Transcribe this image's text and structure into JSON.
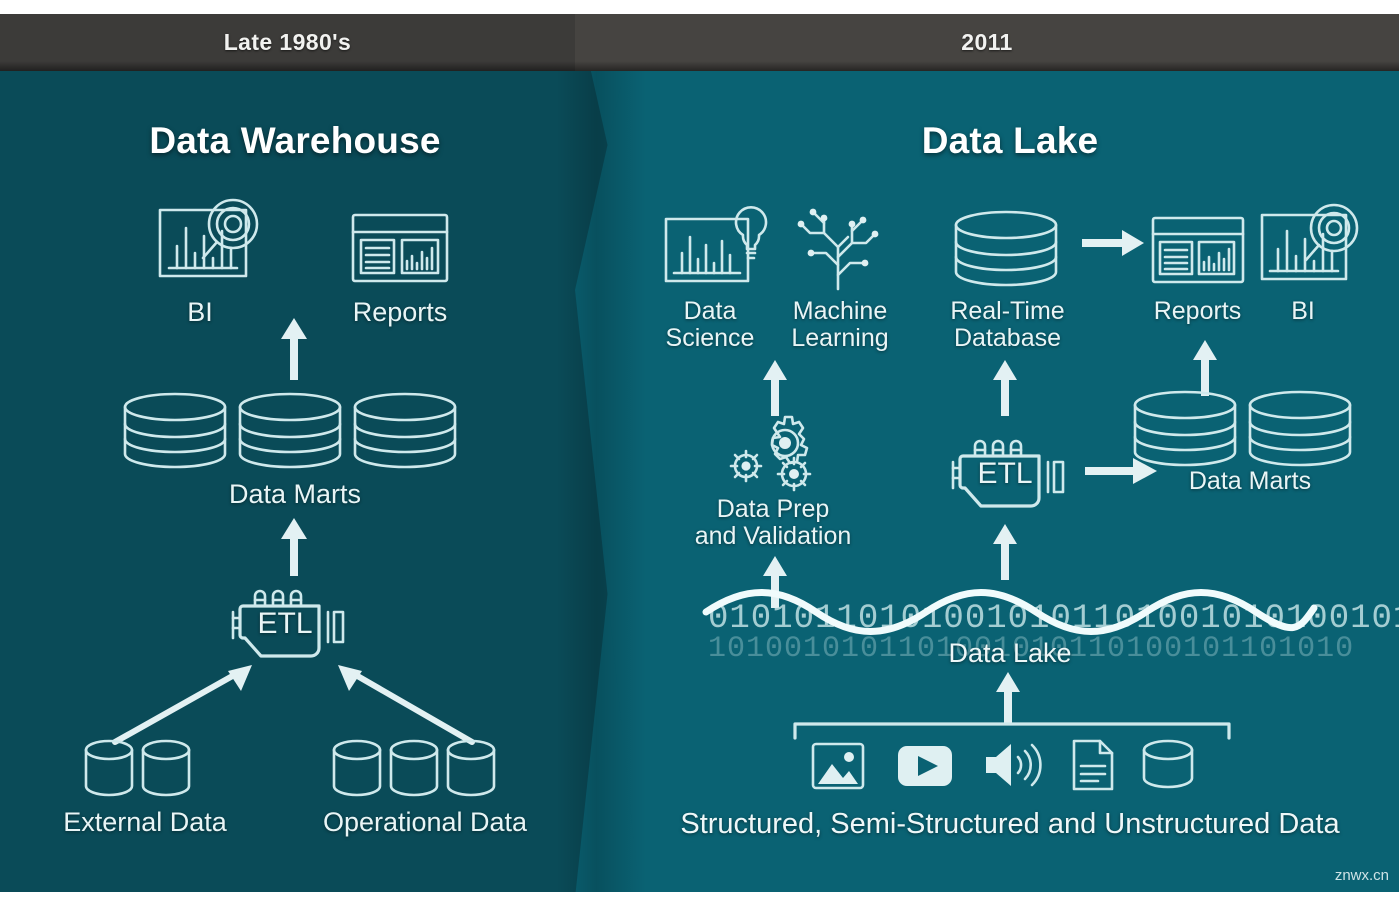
{
  "headers": {
    "left": "Late 1980's",
    "right": "2011"
  },
  "left_panel": {
    "title": "Data Warehouse",
    "nodes": {
      "bi": "BI",
      "reports": "Reports",
      "data_marts": "Data Marts",
      "etl": "ETL",
      "external_data": "External Data",
      "operational_data": "Operational Data"
    }
  },
  "right_panel": {
    "title": "Data Lake",
    "nodes": {
      "data_science": "Data\nScience",
      "machine_learning": "Machine\nLearning",
      "realtime_db": "Real-Time\nDatabase",
      "reports": "Reports",
      "bi": "BI",
      "data_prep": "Data Prep\nand Validation",
      "etl": "ETL",
      "data_marts": "Data Marts",
      "data_lake": "Data Lake",
      "sources_caption": "Structured, Semi-Structured and Unstructured Data"
    },
    "source_icons": [
      "image-icon",
      "video-icon",
      "audio-icon",
      "document-icon",
      "database-icon"
    ],
    "binary_rows": [
      "0101011010100101011010010101001010",
      "1010010101101001010110100101101010"
    ]
  },
  "watermark": "znwx.cn",
  "colors": {
    "panel_left_bg": "#0a4b58",
    "panel_right_bg": "#0a6273",
    "header_left_bg": "#3c3b39",
    "header_right_bg": "#464441",
    "icon_stroke": "#cfe9ec",
    "text": "#e9f5f6"
  }
}
